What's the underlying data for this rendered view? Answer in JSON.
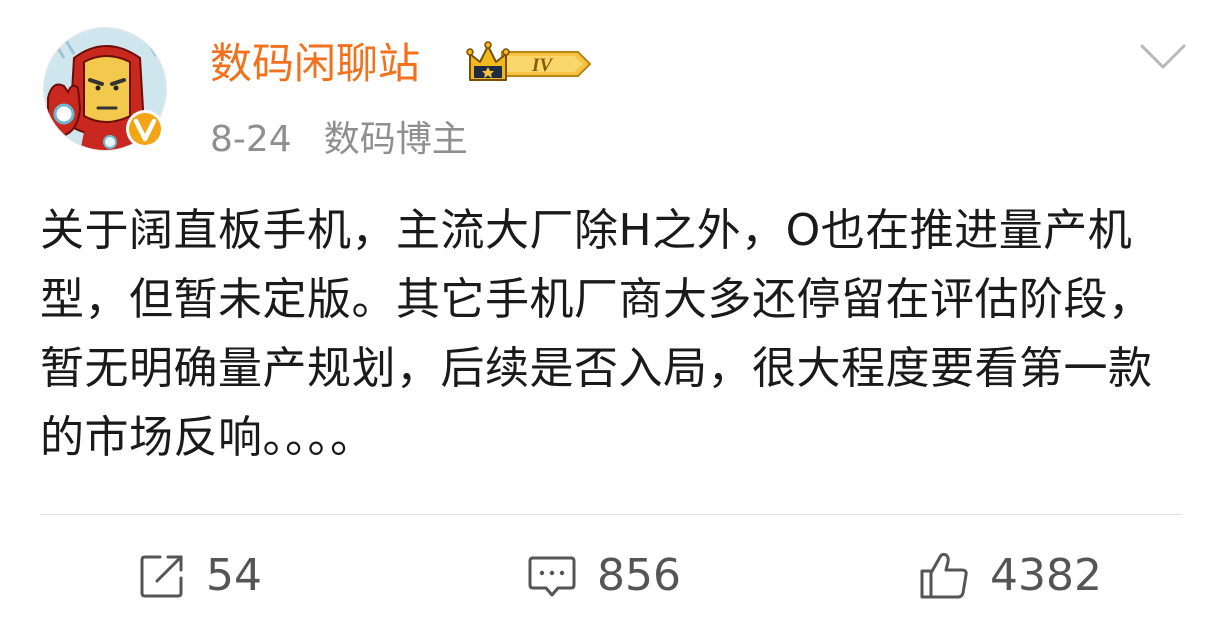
{
  "post": {
    "username": "数码闲聊站",
    "level_badge_text": "IV",
    "date": "8-24",
    "verified_title": "数码博主",
    "content": "关于阔直板手机，主流大厂除H之外，O也在推进量产机型，但暂未定版。其它手机厂商大多还停留在评估阶段，暂无明确量产规划，后续是否入局，很大程度要看第一款的市场反响。。。。"
  },
  "actions": {
    "repost_count": "54",
    "comment_count": "856",
    "like_count": "4382"
  },
  "colors": {
    "username": "#f2711c",
    "meta_text": "#8f8f8f",
    "content_text": "#1a1a1a",
    "action_text": "#555555",
    "verify_badge": "#f2a515",
    "divider": "#e3e3e3"
  },
  "icons": {
    "avatar": "iron-man-avatar",
    "verify": "verified-v-icon",
    "level": "crown-level-icon",
    "more": "chevron-down-icon",
    "repost": "repost-icon",
    "comment": "comment-icon",
    "like": "thumbs-up-icon"
  }
}
